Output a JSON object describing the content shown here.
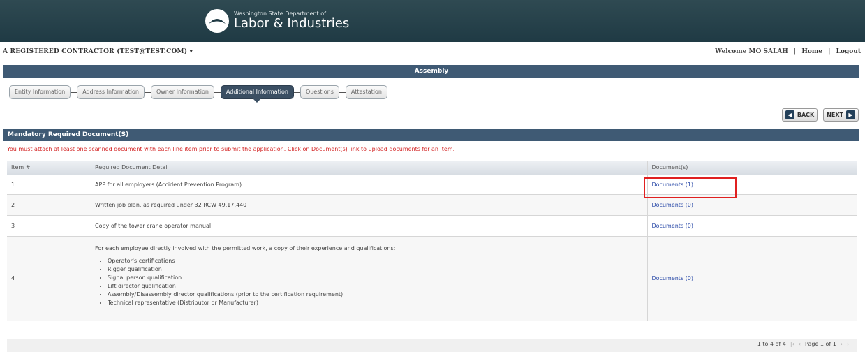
{
  "banner": {
    "org_line": "Washington State Department of",
    "org_name": "Labor & Industries"
  },
  "userbar": {
    "account": "A REGISTERED CONTRACTOR  (TEST@TEST.COM)",
    "account_caret": "▾",
    "welcome": "Welcome MO SALAH",
    "home": "Home",
    "logout": "Logout",
    "separator": "|"
  },
  "section_title": "Assembly",
  "steps": [
    {
      "label": "Entity Information"
    },
    {
      "label": "Address Information"
    },
    {
      "label": "Owner Information"
    },
    {
      "label": "Additional Information",
      "active": true
    },
    {
      "label": "Questions"
    },
    {
      "label": "Attestation"
    }
  ],
  "nav": {
    "back": "BACK",
    "next": "NEXT"
  },
  "panel": {
    "title": "Mandatory Required Document(S)",
    "warning": "You must attach at least one scanned document with each line item prior to submit the application. Click on Document(s) link to upload documents for an item."
  },
  "table": {
    "headers": [
      "Item #",
      "Required Document Detail",
      "Document(s)"
    ],
    "rows": [
      {
        "num": "1",
        "detail": "APP for all employers (Accident Prevention Program)",
        "docs": "Documents (1)"
      },
      {
        "num": "2",
        "detail": "Written job plan, as required under 32 RCW 49.17.440",
        "docs": "Documents (0)"
      },
      {
        "num": "3",
        "detail": "Copy of the tower crane operator manual",
        "docs": "Documents (0)"
      },
      {
        "num": "4",
        "detail": "For each employee directly involved with the permitted work, a copy of their experience and qualifications:",
        "docs": "Documents (0)"
      }
    ],
    "row4_bullets": [
      "Operator's certifications",
      "Rigger qualification",
      "Signal person qualification",
      "Lift director qualification",
      "Assembly/Disassembly director qualifications (prior to the certification requirement)",
      "Technical representative (Distributor or Manufacturer)"
    ]
  },
  "pager": {
    "range": "1 to 4 of 4",
    "page": "Page 1 of 1"
  },
  "colors": {
    "banner": "#1f3a44",
    "bar": "#3f5a74",
    "warning": "#d32222",
    "link": "#2a4aa8",
    "highlight": "#e02020"
  }
}
